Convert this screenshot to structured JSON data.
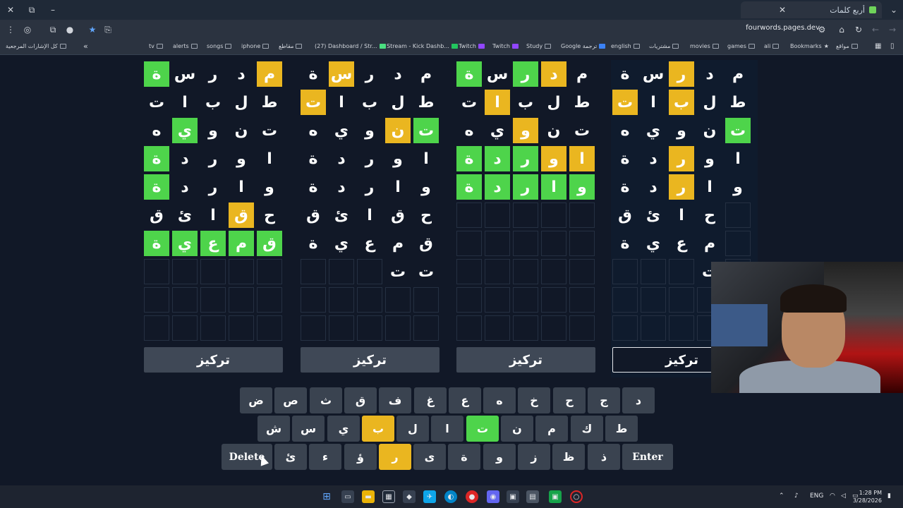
{
  "browser": {
    "tab_title": "أربع كلمات",
    "url": "fourwords.pages.dev",
    "new_tab_icon": "+",
    "close_icon": "✕"
  },
  "bookmarks": {
    "right_label": "كل الإشارات المرجعية",
    "overflow": "«",
    "items": [
      "tv",
      "alerts",
      "songs",
      "iphone",
      "مقاطع",
      "(27) Dashboard / Str...",
      "Stream - Kick Dashb...",
      "Twitch",
      "Twitch",
      "Study",
      "Google ترجمة",
      "english",
      "مشتريات",
      "movies",
      "games",
      "ali",
      "Bookmarks",
      "مواقع"
    ]
  },
  "boards": [
    {
      "rows": [
        [
          {
            "l": "ة",
            "s": "g"
          },
          {
            "l": "س",
            "s": "n"
          },
          {
            "l": "ر",
            "s": "n"
          },
          {
            "l": "د",
            "s": "n"
          },
          {
            "l": "م",
            "s": "y"
          }
        ],
        [
          {
            "l": "ت",
            "s": "n"
          },
          {
            "l": "ا",
            "s": "n"
          },
          {
            "l": "ب",
            "s": "n"
          },
          {
            "l": "ل",
            "s": "n"
          },
          {
            "l": "ط",
            "s": "n"
          }
        ],
        [
          {
            "l": "ه",
            "s": "n"
          },
          {
            "l": "ي",
            "s": "g"
          },
          {
            "l": "و",
            "s": "n"
          },
          {
            "l": "ن",
            "s": "n"
          },
          {
            "l": "ت",
            "s": "n"
          }
        ],
        [
          {
            "l": "ة",
            "s": "g"
          },
          {
            "l": "د",
            "s": "n"
          },
          {
            "l": "ر",
            "s": "n"
          },
          {
            "l": "و",
            "s": "n"
          },
          {
            "l": "ا",
            "s": "n"
          }
        ],
        [
          {
            "l": "ة",
            "s": "g"
          },
          {
            "l": "د",
            "s": "n"
          },
          {
            "l": "ر",
            "s": "n"
          },
          {
            "l": "ا",
            "s": "n"
          },
          {
            "l": "و",
            "s": "n"
          }
        ],
        [
          {
            "l": "ق",
            "s": "n"
          },
          {
            "l": "ئ",
            "s": "n"
          },
          {
            "l": "ا",
            "s": "n"
          },
          {
            "l": "ق",
            "s": "y"
          },
          {
            "l": "ح",
            "s": "n"
          }
        ],
        [
          {
            "l": "ة",
            "s": "g"
          },
          {
            "l": "ي",
            "s": "g"
          },
          {
            "l": "ع",
            "s": "g"
          },
          {
            "l": "م",
            "s": "g"
          },
          {
            "l": "ق",
            "s": "g"
          }
        ],
        [
          {
            "l": "",
            "s": "e"
          },
          {
            "l": "",
            "s": "e"
          },
          {
            "l": "",
            "s": "e"
          },
          {
            "l": "",
            "s": "e"
          },
          {
            "l": "",
            "s": "e"
          }
        ],
        [
          {
            "l": "",
            "s": "e"
          },
          {
            "l": "",
            "s": "e"
          },
          {
            "l": "",
            "s": "e"
          },
          {
            "l": "",
            "s": "e"
          },
          {
            "l": "",
            "s": "e"
          }
        ],
        [
          {
            "l": "",
            "s": "e"
          },
          {
            "l": "",
            "s": "e"
          },
          {
            "l": "",
            "s": "e"
          },
          {
            "l": "",
            "s": "e"
          },
          {
            "l": "",
            "s": "e"
          }
        ]
      ],
      "focus_label": "تركيز"
    },
    {
      "rows": [
        [
          {
            "l": "ة",
            "s": "n"
          },
          {
            "l": "س",
            "s": "y"
          },
          {
            "l": "ر",
            "s": "n"
          },
          {
            "l": "د",
            "s": "n"
          },
          {
            "l": "م",
            "s": "n"
          }
        ],
        [
          {
            "l": "ت",
            "s": "y"
          },
          {
            "l": "ا",
            "s": "n"
          },
          {
            "l": "ب",
            "s": "n"
          },
          {
            "l": "ل",
            "s": "n"
          },
          {
            "l": "ط",
            "s": "n"
          }
        ],
        [
          {
            "l": "ه",
            "s": "n"
          },
          {
            "l": "ي",
            "s": "n"
          },
          {
            "l": "و",
            "s": "n"
          },
          {
            "l": "ن",
            "s": "y"
          },
          {
            "l": "ت",
            "s": "g"
          }
        ],
        [
          {
            "l": "ة",
            "s": "n"
          },
          {
            "l": "د",
            "s": "n"
          },
          {
            "l": "ر",
            "s": "n"
          },
          {
            "l": "و",
            "s": "n"
          },
          {
            "l": "ا",
            "s": "n"
          }
        ],
        [
          {
            "l": "ة",
            "s": "n"
          },
          {
            "l": "د",
            "s": "n"
          },
          {
            "l": "ر",
            "s": "n"
          },
          {
            "l": "ا",
            "s": "n"
          },
          {
            "l": "و",
            "s": "n"
          }
        ],
        [
          {
            "l": "ق",
            "s": "n"
          },
          {
            "l": "ئ",
            "s": "n"
          },
          {
            "l": "ا",
            "s": "n"
          },
          {
            "l": "ق",
            "s": "n"
          },
          {
            "l": "ح",
            "s": "n"
          }
        ],
        [
          {
            "l": "ة",
            "s": "n"
          },
          {
            "l": "ي",
            "s": "n"
          },
          {
            "l": "ع",
            "s": "n"
          },
          {
            "l": "م",
            "s": "n"
          },
          {
            "l": "ق",
            "s": "n"
          }
        ],
        [
          {
            "l": "",
            "s": "e"
          },
          {
            "l": "",
            "s": "e"
          },
          {
            "l": "",
            "s": "e"
          },
          {
            "l": "ت",
            "s": "n"
          },
          {
            "l": "ت",
            "s": "n"
          }
        ],
        [
          {
            "l": "",
            "s": "e"
          },
          {
            "l": "",
            "s": "e"
          },
          {
            "l": "",
            "s": "e"
          },
          {
            "l": "",
            "s": "e"
          },
          {
            "l": "",
            "s": "e"
          }
        ],
        [
          {
            "l": "",
            "s": "e"
          },
          {
            "l": "",
            "s": "e"
          },
          {
            "l": "",
            "s": "e"
          },
          {
            "l": "",
            "s": "e"
          },
          {
            "l": "",
            "s": "e"
          }
        ]
      ],
      "focus_label": "تركيز"
    },
    {
      "rows": [
        [
          {
            "l": "ة",
            "s": "g"
          },
          {
            "l": "س",
            "s": "n"
          },
          {
            "l": "ر",
            "s": "g"
          },
          {
            "l": "د",
            "s": "y"
          },
          {
            "l": "م",
            "s": "n"
          }
        ],
        [
          {
            "l": "ت",
            "s": "n"
          },
          {
            "l": "ا",
            "s": "y"
          },
          {
            "l": "ب",
            "s": "n"
          },
          {
            "l": "ل",
            "s": "n"
          },
          {
            "l": "ط",
            "s": "n"
          }
        ],
        [
          {
            "l": "ه",
            "s": "n"
          },
          {
            "l": "ي",
            "s": "n"
          },
          {
            "l": "و",
            "s": "y"
          },
          {
            "l": "ن",
            "s": "n"
          },
          {
            "l": "ت",
            "s": "n"
          }
        ],
        [
          {
            "l": "ة",
            "s": "g"
          },
          {
            "l": "د",
            "s": "g"
          },
          {
            "l": "ر",
            "s": "g"
          },
          {
            "l": "و",
            "s": "y"
          },
          {
            "l": "ا",
            "s": "y"
          }
        ],
        [
          {
            "l": "ة",
            "s": "g"
          },
          {
            "l": "د",
            "s": "g"
          },
          {
            "l": "ر",
            "s": "g"
          },
          {
            "l": "ا",
            "s": "g"
          },
          {
            "l": "و",
            "s": "g"
          }
        ],
        [
          {
            "l": "",
            "s": "e"
          },
          {
            "l": "",
            "s": "e"
          },
          {
            "l": "",
            "s": "e"
          },
          {
            "l": "",
            "s": "e"
          },
          {
            "l": "",
            "s": "e"
          }
        ],
        [
          {
            "l": "",
            "s": "e"
          },
          {
            "l": "",
            "s": "e"
          },
          {
            "l": "",
            "s": "e"
          },
          {
            "l": "",
            "s": "e"
          },
          {
            "l": "",
            "s": "e"
          }
        ],
        [
          {
            "l": "",
            "s": "e"
          },
          {
            "l": "",
            "s": "e"
          },
          {
            "l": "",
            "s": "e"
          },
          {
            "l": "",
            "s": "e"
          },
          {
            "l": "",
            "s": "e"
          }
        ],
        [
          {
            "l": "",
            "s": "e"
          },
          {
            "l": "",
            "s": "e"
          },
          {
            "l": "",
            "s": "e"
          },
          {
            "l": "",
            "s": "e"
          },
          {
            "l": "",
            "s": "e"
          }
        ],
        [
          {
            "l": "",
            "s": "e"
          },
          {
            "l": "",
            "s": "e"
          },
          {
            "l": "",
            "s": "e"
          },
          {
            "l": "",
            "s": "e"
          },
          {
            "l": "",
            "s": "e"
          }
        ]
      ],
      "focus_label": "تركيز"
    },
    {
      "rows": [
        [
          {
            "l": "ة",
            "s": "n"
          },
          {
            "l": "س",
            "s": "n"
          },
          {
            "l": "ر",
            "s": "y"
          },
          {
            "l": "د",
            "s": "n"
          },
          {
            "l": "م",
            "s": "n"
          }
        ],
        [
          {
            "l": "ت",
            "s": "y"
          },
          {
            "l": "ا",
            "s": "n"
          },
          {
            "l": "ب",
            "s": "y"
          },
          {
            "l": "ل",
            "s": "n"
          },
          {
            "l": "ط",
            "s": "n"
          }
        ],
        [
          {
            "l": "ه",
            "s": "n"
          },
          {
            "l": "ي",
            "s": "n"
          },
          {
            "l": "و",
            "s": "n"
          },
          {
            "l": "ن",
            "s": "n"
          },
          {
            "l": "ت",
            "s": "g"
          }
        ],
        [
          {
            "l": "ة",
            "s": "n"
          },
          {
            "l": "د",
            "s": "n"
          },
          {
            "l": "ر",
            "s": "y"
          },
          {
            "l": "و",
            "s": "n"
          },
          {
            "l": "ا",
            "s": "n"
          }
        ],
        [
          {
            "l": "ة",
            "s": "n"
          },
          {
            "l": "د",
            "s": "n"
          },
          {
            "l": "ر",
            "s": "y"
          },
          {
            "l": "ا",
            "s": "n"
          },
          {
            "l": "و",
            "s": "n"
          }
        ],
        [
          {
            "l": "ق",
            "s": "n"
          },
          {
            "l": "ئ",
            "s": "n"
          },
          {
            "l": "ا",
            "s": "n"
          },
          {
            "l": "ح",
            "s": "n"
          },
          {
            "l": "",
            "s": "n"
          }
        ],
        [
          {
            "l": "ة",
            "s": "n"
          },
          {
            "l": "ي",
            "s": "n"
          },
          {
            "l": "ع",
            "s": "n"
          },
          {
            "l": "م",
            "s": "n"
          },
          {
            "l": "",
            "s": "n"
          }
        ],
        [
          {
            "l": "",
            "s": "e"
          },
          {
            "l": "",
            "s": "e"
          },
          {
            "l": "",
            "s": "e"
          },
          {
            "l": "ت",
            "s": "n"
          },
          {
            "l": "",
            "s": "n"
          }
        ],
        [
          {
            "l": "",
            "s": "e"
          },
          {
            "l": "",
            "s": "e"
          },
          {
            "l": "",
            "s": "e"
          },
          {
            "l": "",
            "s": "e"
          },
          {
            "l": "",
            "s": "e"
          }
        ],
        [
          {
            "l": "",
            "s": "e"
          },
          {
            "l": "",
            "s": "e"
          },
          {
            "l": "",
            "s": "e"
          },
          {
            "l": "",
            "s": "e"
          },
          {
            "l": "",
            "s": "e"
          }
        ]
      ],
      "focus_label": "تركيز",
      "selected": true
    }
  ],
  "keyboard": {
    "row1": [
      {
        "k": "ض",
        "s": "n"
      },
      {
        "k": "ص",
        "s": "n"
      },
      {
        "k": "ث",
        "s": "n"
      },
      {
        "k": "ق",
        "s": "n"
      },
      {
        "k": "ف",
        "s": "n"
      },
      {
        "k": "غ",
        "s": "n"
      },
      {
        "k": "ع",
        "s": "n"
      },
      {
        "k": "ه",
        "s": "n"
      },
      {
        "k": "خ",
        "s": "n"
      },
      {
        "k": "ح",
        "s": "n"
      },
      {
        "k": "ج",
        "s": "n"
      },
      {
        "k": "د",
        "s": "n"
      }
    ],
    "row2": [
      {
        "k": "ش",
        "s": "n"
      },
      {
        "k": "س",
        "s": "n"
      },
      {
        "k": "ي",
        "s": "n"
      },
      {
        "k": "ب",
        "s": "y"
      },
      {
        "k": "ل",
        "s": "n"
      },
      {
        "k": "ا",
        "s": "n"
      },
      {
        "k": "ت",
        "s": "g"
      },
      {
        "k": "ن",
        "s": "n"
      },
      {
        "k": "م",
        "s": "n"
      },
      {
        "k": "ك",
        "s": "n"
      },
      {
        "k": "ط",
        "s": "n"
      }
    ],
    "row3": [
      {
        "k": "Delete",
        "s": "w"
      },
      {
        "k": "ئ",
        "s": "n"
      },
      {
        "k": "ء",
        "s": "n"
      },
      {
        "k": "ؤ",
        "s": "n"
      },
      {
        "k": "ر",
        "s": "y"
      },
      {
        "k": "ى",
        "s": "n"
      },
      {
        "k": "ة",
        "s": "n"
      },
      {
        "k": "و",
        "s": "n"
      },
      {
        "k": "ز",
        "s": "n"
      },
      {
        "k": "ظ",
        "s": "n"
      },
      {
        "k": "ذ",
        "s": "n"
      },
      {
        "k": "Enter",
        "s": "w"
      }
    ]
  },
  "taskbar": {
    "lang": "ENG",
    "time": "1:28 PM",
    "date": "3/28/2026"
  },
  "colors": {
    "correct": "#4ed44b",
    "present": "#eab620",
    "absent": "#3a4350",
    "background": "#111827"
  }
}
